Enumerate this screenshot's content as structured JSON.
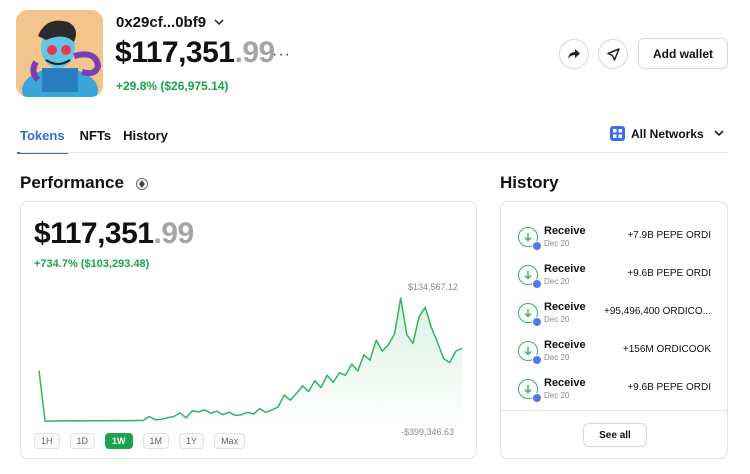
{
  "wallet": {
    "address": "0x29cf...0bf9",
    "balance_whole": "$117,351",
    "balance_decimal": ".99",
    "change": "+29.8% ($26,975.14)"
  },
  "header_actions": {
    "add_wallet_label": "Add wallet"
  },
  "tabs": [
    {
      "label": "Tokens",
      "active": true
    },
    {
      "label": "NFTs",
      "active": false
    },
    {
      "label": "History",
      "active": false
    }
  ],
  "networks": {
    "label": "All Networks"
  },
  "performance": {
    "title": "Performance",
    "value_whole": "$117,351",
    "value_decimal": ".99",
    "change": "+734.7% ($103,293.48)",
    "max_label": "$134,567.12",
    "min_label": "-$399,346.63",
    "ranges": [
      {
        "label": "1H",
        "active": false
      },
      {
        "label": "1D",
        "active": false
      },
      {
        "label": "1W",
        "active": true
      },
      {
        "label": "1M",
        "active": false
      },
      {
        "label": "1Y",
        "active": false
      },
      {
        "label": "Max",
        "active": false
      }
    ]
  },
  "history": {
    "title": "History",
    "items": [
      {
        "type": "Receive",
        "date": "Dec 20",
        "amount": "+7.9B PEPE ORDI"
      },
      {
        "type": "Receive",
        "date": "Dec 20",
        "amount": "+9.6B PEPE ORDI"
      },
      {
        "type": "Receive",
        "date": "Dec 20",
        "amount": "+95,496,400 ORDICO..."
      },
      {
        "type": "Receive",
        "date": "Dec 20",
        "amount": "+156M ORDICOOK"
      },
      {
        "type": "Receive",
        "date": "Dec 20",
        "amount": "+9.6B PEPE ORDI"
      }
    ],
    "see_all_label": "See all"
  },
  "colors": {
    "accent": "#2f6fce",
    "positive": "#1aa34a",
    "chart_line": "#2fb562"
  },
  "chart_data": {
    "type": "line",
    "title": "",
    "xlabel": "",
    "ylabel": "",
    "ylim": [
      -399346.63,
      134567.12
    ],
    "series": [
      {
        "values": [
          -180000,
          -400000,
          -399346.63,
          -399000,
          -398500,
          -398800,
          -398400,
          -398700,
          -398200,
          -398500,
          -398000,
          -398300,
          -397800,
          -397500,
          -398000,
          -397600,
          -397200,
          -396800,
          -380000,
          -394000,
          -392000,
          -385000,
          -380000,
          -364000,
          -386000,
          -355000,
          -360000,
          -351000,
          -365000,
          -357000,
          -372000,
          -361000,
          -375000,
          -372000,
          -362000,
          -369000,
          -346000,
          -362000,
          -351000,
          -338000,
          -287000,
          -309000,
          -279000,
          -247000,
          -271000,
          -224000,
          -254000,
          -201000,
          -231000,
          -190000,
          -201000,
          -152000,
          -182000,
          -112000,
          -135000,
          -48000,
          -96000,
          -68000,
          -21000,
          134567.12,
          -24000,
          -62000,
          54000,
          94000,
          7000,
          -58000,
          -128000,
          -146000,
          -96000,
          -84000
        ]
      }
    ]
  }
}
